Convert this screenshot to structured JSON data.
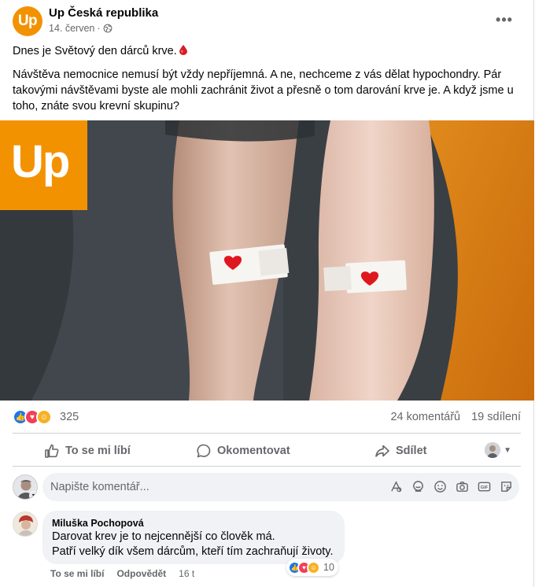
{
  "post": {
    "page_name": "Up Česká republika",
    "logo_text": "Up",
    "date": "14. červen",
    "separator": "·",
    "paragraph1": "Dnes je Světový den dárců krve.",
    "paragraph2": "Návštěva nemocnice nemusí být vždy nepříjemná. A ne, nechceme z vás dělat hypochondry. Pár takovými návštěvami byste ale mohli zachránit život a přesně o tom darování krve je. A když jsme u toho, znáte svou krevní skupinu?",
    "image_logo_text": "Up"
  },
  "summary": {
    "reaction_count": "325",
    "comments": "24 komentářů",
    "shares": "19 sdílení"
  },
  "actions": {
    "like": "To se mi líbí",
    "comment": "Okomentovat",
    "share": "Sdílet"
  },
  "composer": {
    "placeholder": "Napište komentář..."
  },
  "comment": {
    "author": "Miluška Pochopová",
    "line1": "Darovat krev je to nejcennější co člověk má.",
    "line2": "Patří velký dík všem dárcům, kteří tím zachraňují životy.",
    "reaction_count": "10",
    "like": "To se mi líbí",
    "reply": "Odpovědět",
    "time": "16 t"
  },
  "colors": {
    "brand": "#f39200",
    "like": "#1877f2",
    "love": "#f33e58",
    "care": "#f7b125",
    "secondary_text": "#65676b"
  },
  "icons": [
    "globe-icon",
    "more-icon",
    "drop-icon",
    "like-icon",
    "comment-icon",
    "share-icon",
    "chevron-down-icon",
    "sticker-icon",
    "avatar-icon",
    "emoji-icon",
    "camera-icon",
    "gif-icon",
    "sticker2-icon"
  ]
}
